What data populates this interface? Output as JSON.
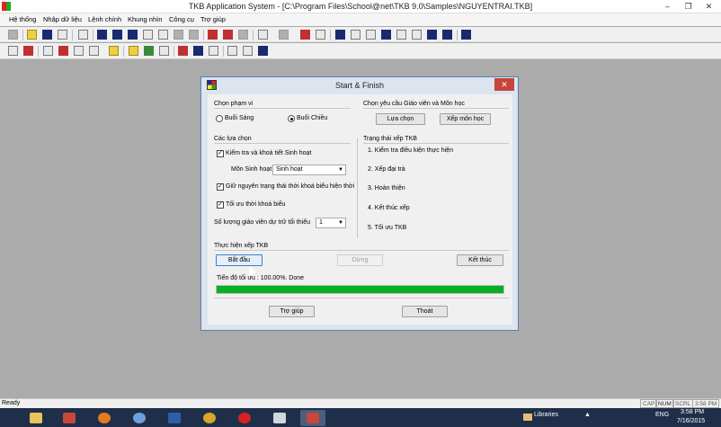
{
  "window": {
    "title": "TKB Application System - [C:\\Program Files\\School@net\\TKB 9.0\\Samples\\NGUYENTRAI.TKB]",
    "minimize": "–",
    "restore": "❐",
    "close": "✕"
  },
  "menu": [
    "Hệ thống",
    "Nhập dữ liệu",
    "Lệnh chính",
    "Khung nhìn",
    "Công cụ",
    "Trợ giúp"
  ],
  "dialog": {
    "title": "Start & Finish",
    "close": "✕",
    "scope": {
      "heading": "Chọn phạm vi",
      "morning": "Buổi Sáng",
      "afternoon": "Buổi Chiều",
      "selected": "afternoon"
    },
    "requirements": {
      "heading": "Chọn yêu cầu Giáo viên và Môn học",
      "select_button": "Lựa chọn",
      "arrange_button": "Xếp môn học"
    },
    "options": {
      "heading": "Các lựa chọn",
      "check_activity": "Kiểm tra và khoá tiết Sinh hoạt",
      "check_activity_checked": true,
      "activity_subject_label": "Môn Sinh hoạt",
      "activity_subject_value": "Sinh hoạt",
      "keep_lock": "Giữ nguyên trạng thái thời khoá biểu hiện thời",
      "keep_lock_checked": true,
      "optimize": "Tối ưu thời khoá biểu",
      "optimize_checked": true,
      "reserve_label": "Số lượng giáo viên dự trữ tối thiểu",
      "reserve_value": "1"
    },
    "status": {
      "heading": "Trạng thái xếp TKB",
      "steps": [
        "1. Kiểm tra điều kiện thực hiện",
        "2. Xếp đại trà",
        "3. Hoàn thiện",
        "4. Kết thúc xếp",
        "5. Tối ưu TKB"
      ]
    },
    "execute": {
      "heading": "Thực hiện xếp TKB",
      "start": "Bắt đầu",
      "stop": "Dừng",
      "finish": "Kết thúc",
      "progress_text": "Tiến độ tối ưu : 100.00%. Done",
      "progress_value": 1.0
    },
    "help_button": "Trợ giúp",
    "exit_button": "Thoát"
  },
  "statusbar": {
    "ready": "Ready",
    "cap": "CAP",
    "num": "NUM",
    "scrl": "SCRL",
    "time": "3:58 PM"
  },
  "taskbar": {
    "libraries": "Libraries",
    "lang": "ENG",
    "clock_time": "3:58 PM",
    "clock_date": "7/16/2015"
  },
  "colors": {
    "progress": "#06b025",
    "dialog_frame": "#dbe4ef",
    "close_red": "#c7443a",
    "taskbar": "#1f2f4a"
  }
}
